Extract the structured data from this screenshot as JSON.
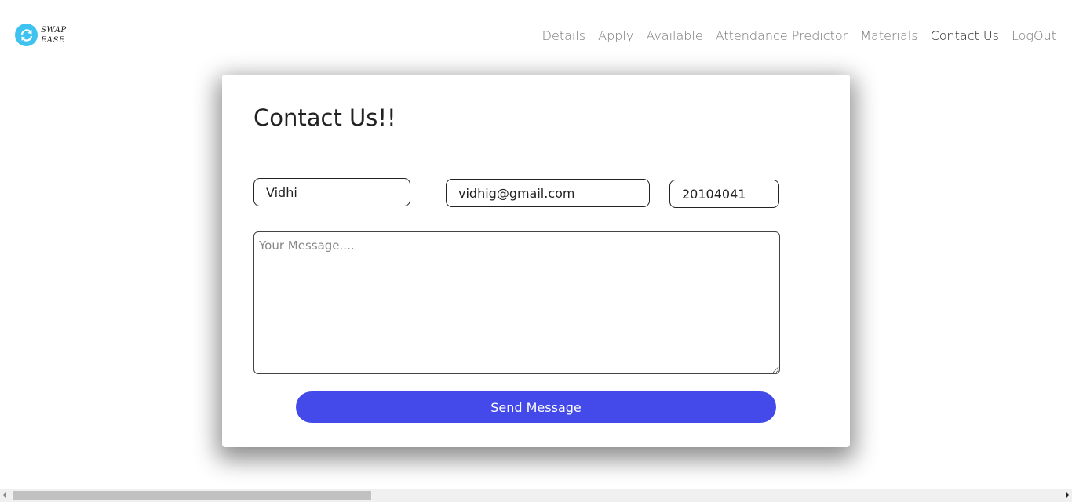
{
  "logo": {
    "line1": "SWAP",
    "line2": "EASE",
    "icon": "swap-arrows-icon",
    "color": "#3ec3f0"
  },
  "nav": {
    "items": [
      {
        "label": "Details",
        "active": false
      },
      {
        "label": "Apply",
        "active": false
      },
      {
        "label": "Available",
        "active": false
      },
      {
        "label": "Attendance Predictor",
        "active": false
      },
      {
        "label": "Materials",
        "active": false
      },
      {
        "label": "Contact Us",
        "active": true
      },
      {
        "label": "LogOut",
        "active": false
      }
    ]
  },
  "form": {
    "title": "Contact Us!!",
    "name_value": "Vidhi",
    "email_value": "vidhig@gmail.com",
    "id_value": "20104041",
    "message_placeholder": "Your Message....",
    "send_label": "Send Message",
    "button_color": "#434ae9"
  }
}
